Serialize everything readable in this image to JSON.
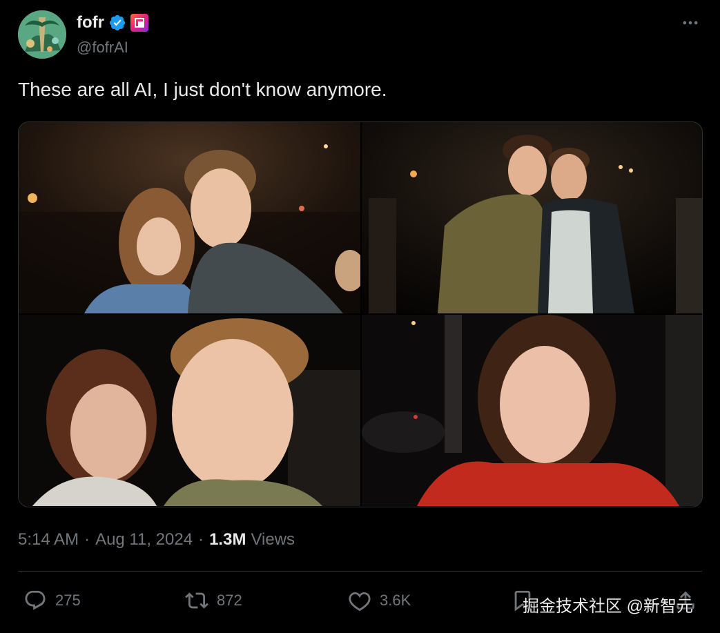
{
  "author": {
    "display_name": "fofr",
    "handle": "@fofrAI",
    "verified": true,
    "affiliation_badge": "app-badge-icon"
  },
  "tweet": {
    "text": "These are all AI, I just don't know anymore.",
    "photos": [
      {
        "name": "photo-couple-bar",
        "description_icon": "image"
      },
      {
        "name": "photo-two-men-party",
        "description_icon": "image"
      },
      {
        "name": "photo-selfie-curly-hair",
        "description_icon": "image"
      },
      {
        "name": "photo-woman-red-jacket",
        "description_icon": "image"
      }
    ]
  },
  "meta": {
    "time": "5:14 AM",
    "dot": "·",
    "date": "Aug 11, 2024",
    "views_count": "1.3M",
    "views_label": "Views"
  },
  "actions": {
    "replies": "275",
    "reposts": "872",
    "likes": "3.6K"
  },
  "watermark": "掘金技术社区 @新智元",
  "colors": {
    "background": "#000000",
    "text_primary": "#e7e9ea",
    "text_secondary": "#71767b",
    "verified_blue": "#1d9bf0",
    "divider": "#2f3336"
  }
}
